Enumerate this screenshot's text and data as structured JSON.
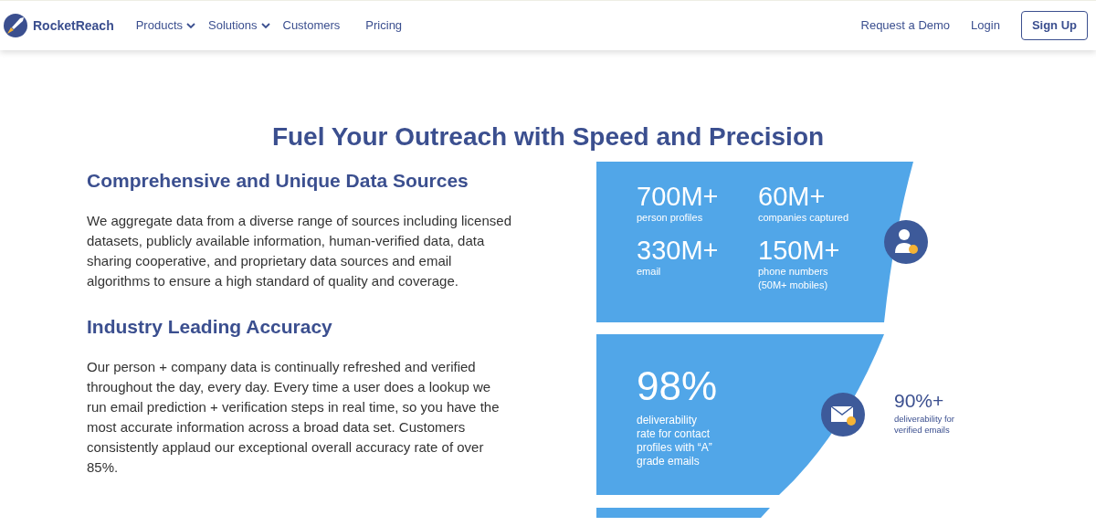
{
  "nav": {
    "brand": "RocketReach",
    "links": [
      {
        "label": "Products",
        "dropdown": true
      },
      {
        "label": "Solutions",
        "dropdown": true
      },
      {
        "label": "Customers",
        "dropdown": false
      },
      {
        "label": "Pricing",
        "dropdown": false
      }
    ],
    "right_links": [
      "Request a Demo",
      "Login"
    ],
    "signup": "Sign Up"
  },
  "heading": "Fuel Your Outreach with Speed and Precision",
  "sections": [
    {
      "title": "Comprehensive and Unique Data Sources",
      "body": "We aggregate data from a diverse range of sources including licensed datasets, publicly available information, human-verified data, data sharing cooperative, and proprietary data sources and email algorithms to ensure a high standard of quality and coverage."
    },
    {
      "title": "Industry Leading Accuracy",
      "body": "Our person + company data is continually refreshed and verified throughout the day, every day. Every time a user does a lookup we run email prediction + verification steps in real time, so you have the most accurate information across a broad data set. Customers consistently applaud our exceptional overall accuracy rate of over 85%."
    }
  ],
  "stats": [
    {
      "value": "700M+",
      "label": "person profiles"
    },
    {
      "value": "60M+",
      "label": "companies captured"
    },
    {
      "value": "330M+",
      "label": "email"
    },
    {
      "value": "150M+",
      "label": "phone numbers\n(50M+ mobiles)"
    }
  ],
  "accuracy": {
    "value": "98%",
    "label": "deliverability\nrate for contact\nprofiles with “A”\ngrade emails"
  },
  "verified": {
    "value": "90%+",
    "label": "deliverability for\nverified emails"
  }
}
